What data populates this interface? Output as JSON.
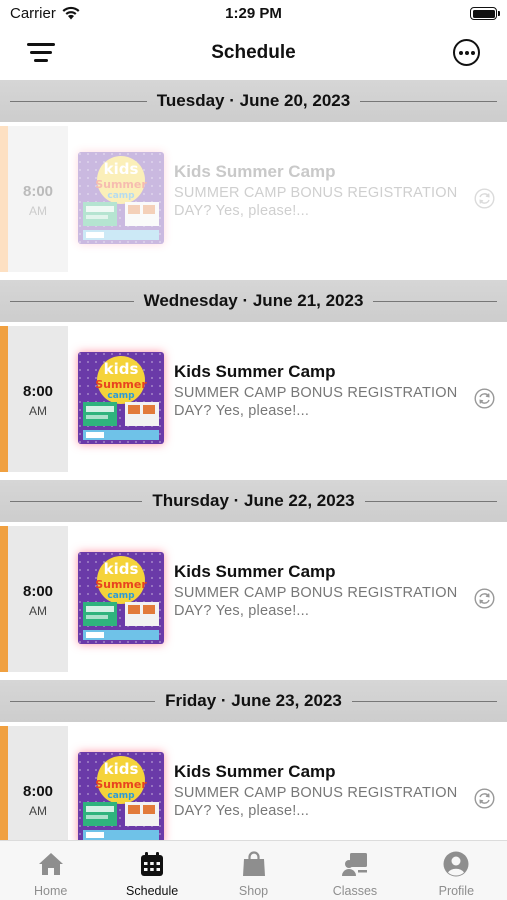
{
  "status_bar": {
    "carrier": "Carrier",
    "time": "1:29 PM"
  },
  "nav": {
    "title": "Schedule",
    "menu_icon": "hamburger-menu-icon",
    "more_icon": "more-options-icon"
  },
  "schedule": [
    {
      "date": "Tuesday · June 20, 2023",
      "faded": true,
      "events": [
        {
          "time": "8:00",
          "ampm": "AM",
          "title": "Kids Summer Camp",
          "description": "SUMMER CAMP BONUS REGISTRATION DAY?  Yes, please!...",
          "thumb_label": "kids summer camp"
        }
      ]
    },
    {
      "date": "Wednesday · June 21, 2023",
      "faded": false,
      "events": [
        {
          "time": "8:00",
          "ampm": "AM",
          "title": "Kids Summer Camp",
          "description": "SUMMER CAMP BONUS REGISTRATION DAY?  Yes, please!...",
          "thumb_label": "kids summer camp"
        }
      ]
    },
    {
      "date": "Thursday · June 22, 2023",
      "faded": false,
      "events": [
        {
          "time": "8:00",
          "ampm": "AM",
          "title": "Kids Summer Camp",
          "description": "SUMMER CAMP BONUS REGISTRATION DAY?  Yes, please!...",
          "thumb_label": "kids summer camp"
        }
      ]
    },
    {
      "date": "Friday · June 23, 2023",
      "faded": false,
      "events": [
        {
          "time": "8:00",
          "ampm": "AM",
          "title": "Kids Summer Camp",
          "description": "SUMMER CAMP BONUS REGISTRATION DAY?  Yes, please!...",
          "thumb_label": "kids summer camp"
        }
      ]
    }
  ],
  "tabs": [
    {
      "label": "Home",
      "icon": "home-icon",
      "active": false
    },
    {
      "label": "Schedule",
      "icon": "calendar-icon",
      "active": true
    },
    {
      "label": "Shop",
      "icon": "shopping-bag-icon",
      "active": false
    },
    {
      "label": "Classes",
      "icon": "classes-icon",
      "active": false
    },
    {
      "label": "Profile",
      "icon": "profile-icon",
      "active": false
    }
  ],
  "colors": {
    "accent": "#f0a040",
    "active_tab": "#111111",
    "inactive_tab": "#8e8e8e",
    "date_header_bg": "#d0d0d0"
  }
}
